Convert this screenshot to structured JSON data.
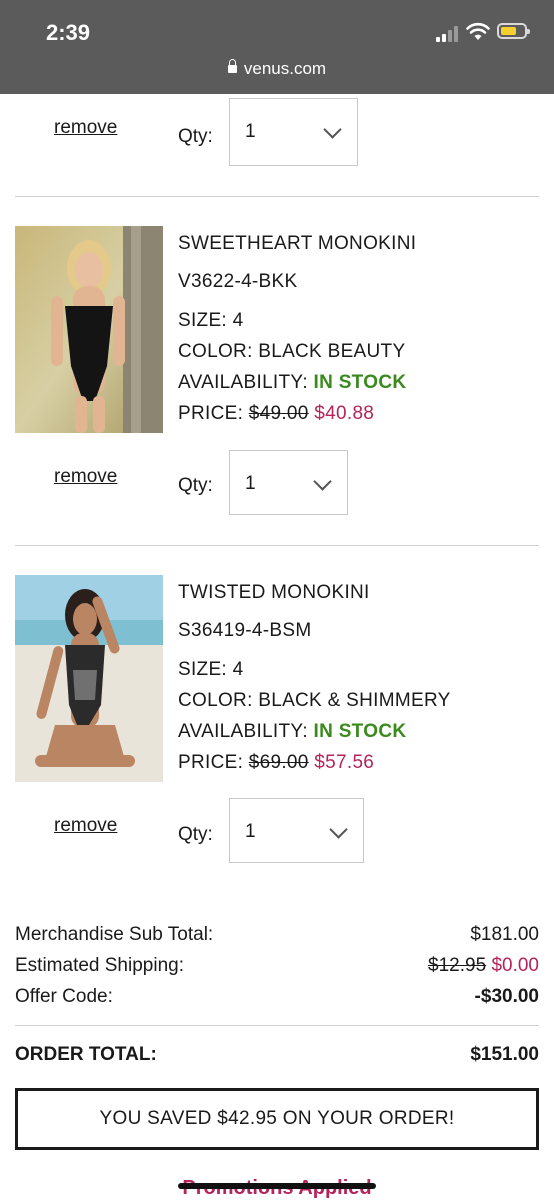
{
  "status": {
    "time": "2:39",
    "url": "venus.com"
  },
  "first_item": {
    "remove_label": "remove",
    "qty_label": "Qty:",
    "qty_value": "1"
  },
  "items": [
    {
      "name": "SWEETHEART MONOKINI",
      "sku": "V3622-4-BKK",
      "size": "SIZE: 4",
      "color": "COLOR: BLACK BEAUTY",
      "availability_label": "AVAILABILITY:",
      "availability_value": "IN STOCK",
      "price_label": "PRICE:",
      "price_original": "$49.00",
      "price_sale": "$40.88",
      "remove_label": "remove",
      "qty_label": "Qty:",
      "qty_value": "1"
    },
    {
      "name": "TWISTED MONOKINI",
      "sku": "S36419-4-BSM",
      "size": "SIZE: 4",
      "color": "COLOR: BLACK & SHIMMERY",
      "availability_label": "AVAILABILITY:",
      "availability_value": "IN STOCK",
      "price_label": "PRICE:",
      "price_original": "$69.00",
      "price_sale": "$57.56",
      "remove_label": "remove",
      "qty_label": "Qty:",
      "qty_value": "1"
    }
  ],
  "summary": {
    "subtotal_label": "Merchandise Sub Total:",
    "subtotal_value": "$181.00",
    "shipping_label": "Estimated Shipping:",
    "shipping_original": "$12.95",
    "shipping_value": "$0.00",
    "offer_label": "Offer Code:",
    "offer_value": "-$30.00",
    "total_label": "ORDER TOTAL:",
    "total_value": "$151.00"
  },
  "saved_message": "YOU SAVED $42.95 ON YOUR ORDER!",
  "promotions_label": "Promotions Applied",
  "colors": {
    "sale": "#b5245a",
    "in_stock": "#3a8a1e",
    "status_bar": "#5b5b5b"
  }
}
